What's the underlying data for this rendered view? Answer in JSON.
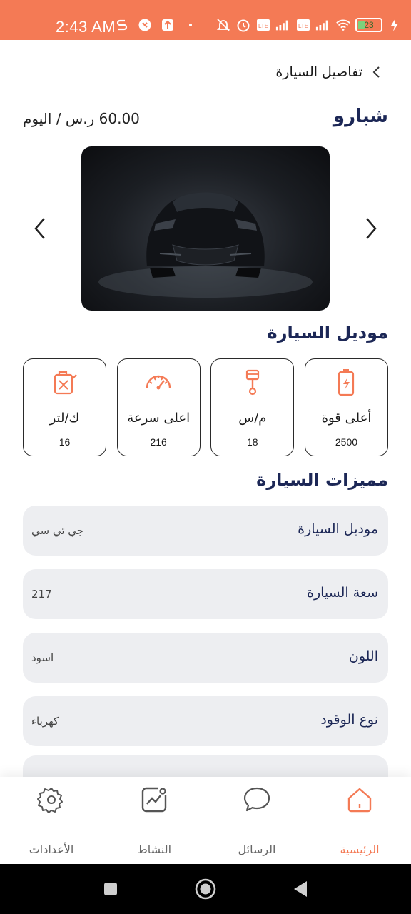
{
  "status_bar": {
    "time": "2:43 AM",
    "battery_level": "23",
    "color": "#F47A55",
    "left_icons": [
      "s-icon",
      "alert-icon",
      "upload-icon",
      "dot-icon"
    ],
    "right_icons": [
      "mute-icon",
      "alarm-icon",
      "volte-icon",
      "signal-icon",
      "volte-icon",
      "signal-icon",
      "wifi-icon",
      "battery-icon",
      "charging-icon"
    ]
  },
  "header": {
    "title": "تفاصيل السيارة",
    "back_icon": "chevron-left-icon"
  },
  "car": {
    "name": "شبارو",
    "price": "60.00 ر.س / اليوم",
    "image_icon": "sports-car-image"
  },
  "sections": {
    "model_title": "موديل السيارة",
    "features_title": "مميزات السيارة"
  },
  "specs": [
    {
      "label": "أعلى قوة",
      "value": "2500",
      "icon": "battery-icon"
    },
    {
      "label": "م/س",
      "value": "18",
      "icon": "piston-icon"
    },
    {
      "label": "اعلى سرعة",
      "value": "216",
      "icon": "speedometer-icon"
    },
    {
      "label": "ك/لتر",
      "value": "16",
      "icon": "fuel-can-icon"
    }
  ],
  "features": [
    {
      "key": "موديل السيارة",
      "value": "جي تي سي"
    },
    {
      "key": "سعة السيارة",
      "value": "217"
    },
    {
      "key": "اللون",
      "value": "اسود"
    },
    {
      "key": "نوع الوقود",
      "value": "كهرباء"
    }
  ],
  "bottom_nav": [
    {
      "label": "الرئيسية",
      "icon": "home-icon",
      "active": true
    },
    {
      "label": "الرسائل",
      "icon": "chat-icon",
      "active": false
    },
    {
      "label": "النشاط",
      "icon": "activity-icon",
      "active": false
    },
    {
      "label": "الأعدادات",
      "icon": "gear-icon",
      "active": false
    }
  ],
  "accent_color": "#F47A55",
  "title_color": "#1c2756"
}
